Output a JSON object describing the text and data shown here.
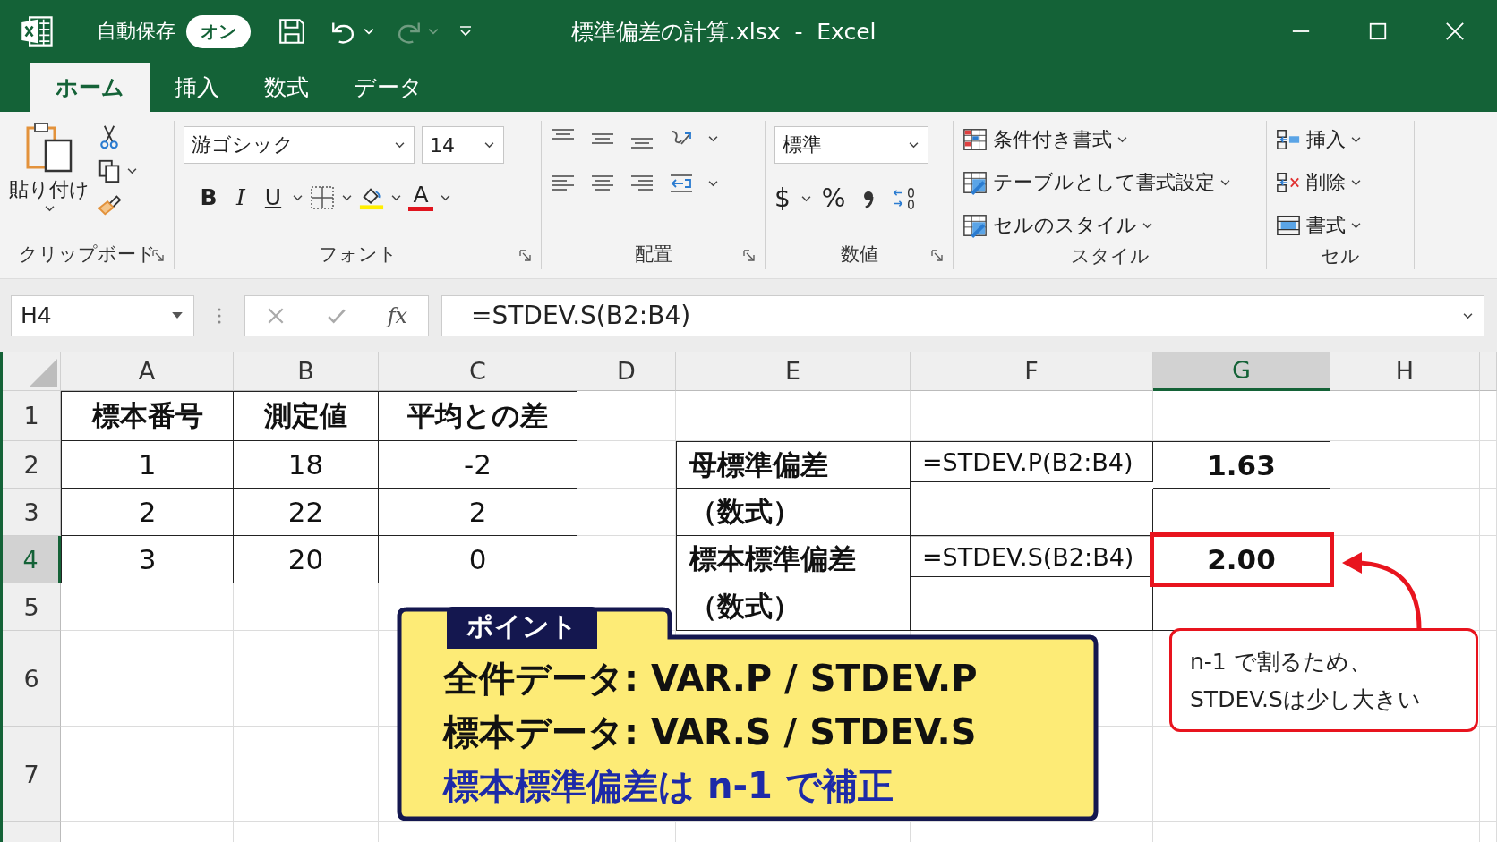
{
  "window": {
    "title": "標準偏差の計算.xlsx  -  Excel"
  },
  "autosave": {
    "label": "自動保存",
    "toggle": "オン",
    "on": true
  },
  "tabs": [
    {
      "label": "ホーム",
      "selected": true
    },
    {
      "label": "挿入",
      "selected": false
    },
    {
      "label": "数式",
      "selected": false
    },
    {
      "label": "データ",
      "selected": false
    }
  ],
  "ribbon": {
    "clipboard": {
      "paste": "貼り付け",
      "label": "クリップボード"
    },
    "font": {
      "name": "游ゴシック",
      "size": "14",
      "bold": "B",
      "italic": "I",
      "underline": "U",
      "font_color": "A",
      "label": "フォント"
    },
    "alignment": {
      "label": "配置"
    },
    "number": {
      "format": "標準",
      "currency": "$",
      "percent": "%",
      "label": "数値"
    },
    "styles": {
      "items": [
        "条件付き書式",
        "テーブルとして書式設定",
        "セルのスタイル"
      ],
      "label": "スタイル"
    },
    "cells": {
      "items": [
        "挿入",
        "削除",
        "書式"
      ],
      "label": "セル"
    }
  },
  "formula_bar": {
    "name_box": "H4",
    "fx": "fx",
    "formula": "=STDEV.S(B2:B4)"
  },
  "sheet": {
    "columns": [
      {
        "label": "A",
        "selected": false
      },
      {
        "label": "B",
        "selected": false
      },
      {
        "label": "C",
        "selected": false
      },
      {
        "label": "D",
        "selected": false
      },
      {
        "label": "E",
        "selected": false
      },
      {
        "label": "F",
        "selected": false
      },
      {
        "label": "G",
        "selected": true
      },
      {
        "label": "H",
        "selected": false
      }
    ],
    "rows": [
      {
        "label": "1",
        "selected": false,
        "cells": {
          "A": {
            "text": "標本番号",
            "highlighted": false
          },
          "B": {
            "text": "測定値",
            "highlighted": false
          },
          "C": {
            "text": "平均との差",
            "highlighted": false
          }
        }
      },
      {
        "label": "2",
        "selected": false,
        "cells": {
          "A": {
            "text": "1",
            "highlighted": false
          },
          "B": {
            "text": "18",
            "highlighted": false
          },
          "C": {
            "text": "-2",
            "highlighted": false
          },
          "E": {
            "text": "母標準偏差",
            "highlighted": false
          },
          "F": {
            "text": "=STDEV.P(B2:B4)",
            "highlighted": false
          },
          "G": {
            "text": "1.63",
            "highlighted": false
          }
        }
      },
      {
        "label": "3",
        "selected": false,
        "cells": {
          "A": {
            "text": "2",
            "highlighted": false
          },
          "B": {
            "text": "22",
            "highlighted": false
          },
          "C": {
            "text": "2",
            "highlighted": false
          },
          "E": {
            "text": "（数式）",
            "highlighted": false
          }
        }
      },
      {
        "label": "4",
        "selected": true,
        "cells": {
          "A": {
            "text": "3",
            "highlighted": false
          },
          "B": {
            "text": "20",
            "highlighted": false
          },
          "C": {
            "text": "0",
            "highlighted": false
          },
          "E": {
            "text": "標本標準偏差",
            "highlighted": false
          },
          "F": {
            "text": "=STDEV.S(B2:B4)",
            "highlighted": false
          },
          "G": {
            "text": "2.00",
            "highlighted": true
          }
        }
      },
      {
        "label": "5",
        "selected": false,
        "cells": {
          "E": {
            "text": "（数式）",
            "highlighted": false
          }
        }
      },
      {
        "label": "6",
        "selected": false,
        "cells": {}
      },
      {
        "label": "7",
        "selected": false,
        "cells": {}
      }
    ]
  },
  "point_note": {
    "tab": "ポイント",
    "lines": [
      {
        "text": "全件データ: VAR.P / STDEV.P",
        "kind": "rule"
      },
      {
        "text": "標本データ: VAR.S / STDEV.S",
        "kind": "rule"
      },
      {
        "text": "標本標準偏差は n-1 で補正",
        "kind": "emphasis"
      }
    ]
  },
  "callout": {
    "lines": [
      "n-1 で割るため、",
      "STDEV.Sは少し大きい"
    ]
  }
}
